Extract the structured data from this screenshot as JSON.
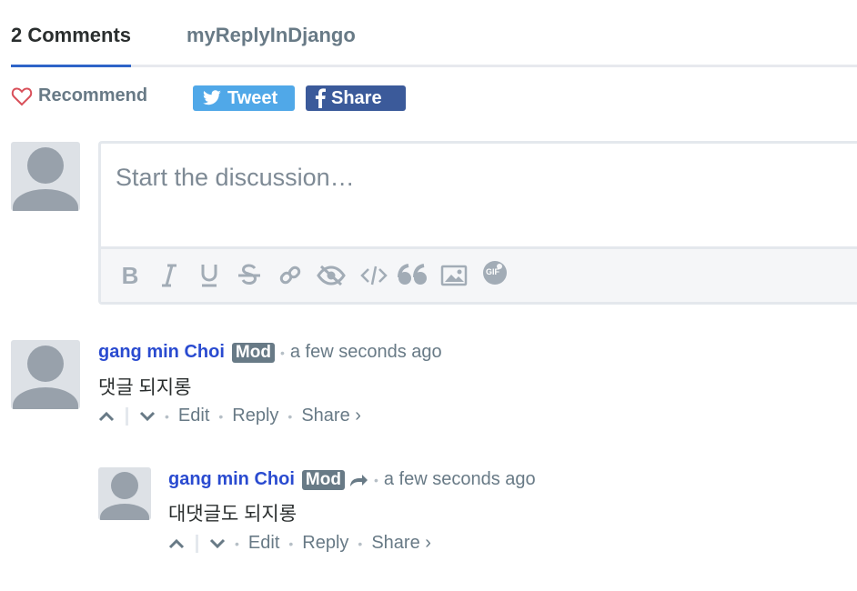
{
  "tabs": {
    "comments_label": "2 Comments",
    "site_label": "myReplyInDjango"
  },
  "actions": {
    "recommend_label": "Recommend",
    "tweet_label": "Tweet",
    "share_label": "Share"
  },
  "composer": {
    "placeholder": "Start the discussion…",
    "toolbar": [
      "bold-icon",
      "italic-icon",
      "underline-icon",
      "strikethrough-icon",
      "link-icon",
      "spoiler-icon",
      "code-icon",
      "quote-icon",
      "image-icon",
      "gif-icon"
    ],
    "gif_label": "GIF"
  },
  "comments": [
    {
      "author": "gang min Choi",
      "badge": "Mod",
      "time": "a few seconds ago",
      "text": "댓글 되지롱",
      "edit": "Edit",
      "reply": "Reply",
      "share": "Share ›"
    },
    {
      "author": "gang min Choi",
      "badge": "Mod",
      "time": "a few seconds ago",
      "text": "대댓글도 되지롱",
      "edit": "Edit",
      "reply": "Reply",
      "share": "Share ›"
    }
  ],
  "colors": {
    "accent": "#2e64c8",
    "author": "#2a4bd0",
    "twitter": "#50a8e8",
    "facebook": "#3b5a9a",
    "muted": "#687a86"
  }
}
